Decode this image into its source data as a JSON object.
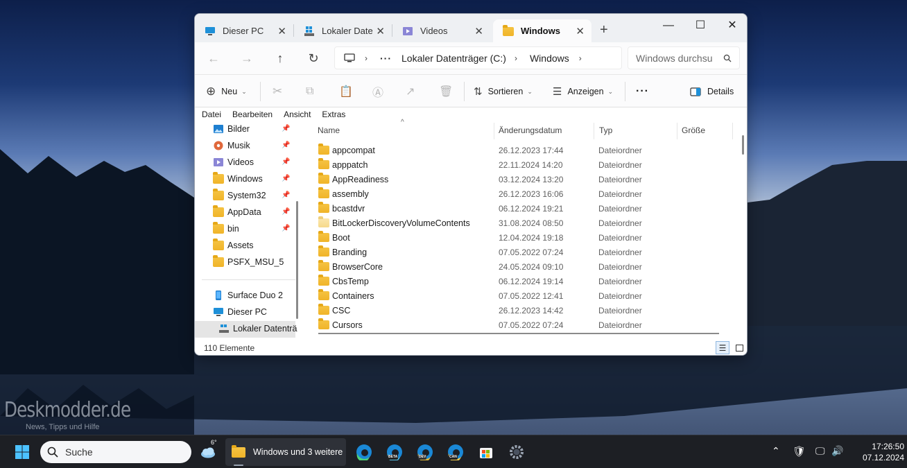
{
  "watermark": {
    "title": "Deskmodder.de",
    "subtitle": "News, Tipps und Hilfe"
  },
  "tabs": [
    {
      "label": "Dieser PC",
      "icon": "monitor-icon"
    },
    {
      "label": "Lokaler Date",
      "icon": "drive-icon"
    },
    {
      "label": "Videos",
      "icon": "video-folder-icon"
    },
    {
      "label": "Windows",
      "icon": "folder-icon"
    }
  ],
  "breadcrumb": [
    "Lokaler Datenträger (C:)",
    "Windows"
  ],
  "search_placeholder": "Windows durchsu",
  "toolbar": {
    "new": "Neu",
    "sort": "Sortieren",
    "view": "Anzeigen",
    "details": "Details"
  },
  "menu": [
    "Datei",
    "Bearbeiten",
    "Ansicht",
    "Extras"
  ],
  "sidebar": {
    "quick": [
      {
        "label": "Bilder",
        "icon": "pictures-icon"
      },
      {
        "label": "Musik",
        "icon": "music-icon"
      },
      {
        "label": "Videos",
        "icon": "videos-icon"
      },
      {
        "label": "Windows",
        "icon": "folder-icon"
      },
      {
        "label": "System32",
        "icon": "folder-icon"
      },
      {
        "label": "AppData",
        "icon": "folder-icon"
      },
      {
        "label": "bin",
        "icon": "folder-icon"
      },
      {
        "label": "Assets",
        "icon": "folder-icon"
      },
      {
        "label": "PSFX_MSU_5",
        "icon": "folder-icon"
      }
    ],
    "devices": [
      {
        "label": "Surface Duo 2",
        "icon": "phone-icon"
      },
      {
        "label": "Dieser PC",
        "icon": "monitor-icon"
      },
      {
        "label": "Lokaler Datenträ",
        "icon": "drive-icon"
      }
    ]
  },
  "columns": [
    "Name",
    "Änderungsdatum",
    "Typ",
    "Größe"
  ],
  "files": [
    {
      "name": "appcompat",
      "date": "26.12.2023 17:44",
      "type": "Dateiordner"
    },
    {
      "name": "apppatch",
      "date": "22.11.2024 14:20",
      "type": "Dateiordner"
    },
    {
      "name": "AppReadiness",
      "date": "03.12.2024 13:20",
      "type": "Dateiordner"
    },
    {
      "name": "assembly",
      "date": "26.12.2023 16:06",
      "type": "Dateiordner"
    },
    {
      "name": "bcastdvr",
      "date": "06.12.2024 19:21",
      "type": "Dateiordner"
    },
    {
      "name": "BitLockerDiscoveryVolumeContents",
      "date": "31.08.2024 08:50",
      "type": "Dateiordner"
    },
    {
      "name": "Boot",
      "date": "12.04.2024 19:18",
      "type": "Dateiordner"
    },
    {
      "name": "Branding",
      "date": "07.05.2022 07:24",
      "type": "Dateiordner"
    },
    {
      "name": "BrowserCore",
      "date": "24.05.2024 09:10",
      "type": "Dateiordner"
    },
    {
      "name": "CbsTemp",
      "date": "06.12.2024 19:14",
      "type": "Dateiordner"
    },
    {
      "name": "Containers",
      "date": "07.05.2022 12:41",
      "type": "Dateiordner"
    },
    {
      "name": "CSC",
      "date": "26.12.2023 14:42",
      "type": "Dateiordner"
    },
    {
      "name": "Cursors",
      "date": "07.05.2022 07:24",
      "type": "Dateiordner"
    }
  ],
  "status": {
    "count": "110 Elemente"
  },
  "taskbar": {
    "search": "Suche",
    "weather": "6°",
    "files_label": "Windows und 3 weitere",
    "edge_badges": [
      "BETA",
      "DEV",
      "CAN"
    ],
    "time": "17:26:50",
    "date": "07.12.2024"
  },
  "colors": {
    "accent": "#0067c0",
    "folder": "#f0b429",
    "taskbar": "#1d1f24"
  }
}
